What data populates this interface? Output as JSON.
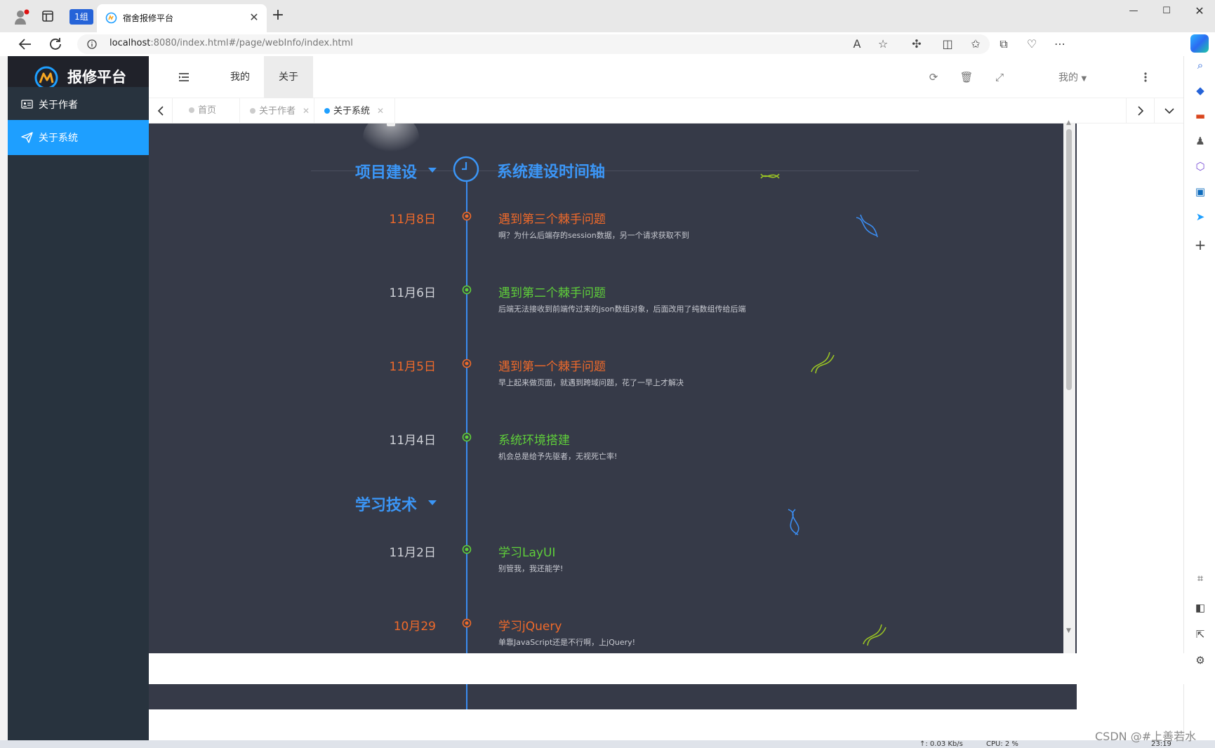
{
  "browser": {
    "tab_group": "1组",
    "tab_title": "宿舍报修平台",
    "url_host": "localhost",
    "url_rest": ":8080/index.html#/page/webInfo/index.html"
  },
  "app": {
    "logo_text": "报修平台",
    "menu": [
      {
        "label": "关于作者",
        "icon": "id-card-icon",
        "active": false
      },
      {
        "label": "关于系统",
        "icon": "paper-plane-icon",
        "active": true
      }
    ],
    "nav": {
      "mine": "我的",
      "about": "关于"
    },
    "user_menu": "我的",
    "page_tabs": [
      {
        "label": "首页",
        "active": false,
        "closable": false
      },
      {
        "label": "关于作者",
        "active": false,
        "closable": true
      },
      {
        "label": "关于系统",
        "active": true,
        "closable": true
      }
    ]
  },
  "timeline": {
    "header_title": "系统建设时间轴",
    "sections": [
      {
        "title": "项目建设"
      },
      {
        "title": "学习技术"
      }
    ],
    "events": [
      {
        "date": "11月8日",
        "title": "遇到第三个棘手问题",
        "desc": "啊？为什么后端存的session数据，另一个请求获取不到",
        "color": "orange"
      },
      {
        "date": "11月6日",
        "title": "遇到第二个棘手问题",
        "desc": "后端无法接收到前端传过来的json数组对象，后面改用了纯数组传给后端",
        "color": "green"
      },
      {
        "date": "11月5日",
        "title": "遇到第一个棘手问题",
        "desc": "早上起来做页面，就遇到跨域问题，花了一早上才解决",
        "color": "orange"
      },
      {
        "date": "11月4日",
        "title": "系统环境搭建",
        "desc": "机会总是给予先驱者，无视死亡率!",
        "color": "green"
      },
      {
        "date": "11月2日",
        "title": "学习LayUI",
        "desc": "别管我，我还能学!",
        "color": "green"
      },
      {
        "date": "10月29",
        "title": "学习jQuery",
        "desc": "单靠JavaScript还是不行啊，上jQuery!",
        "color": "orange"
      }
    ]
  },
  "colors": {
    "accent": "#1e9fff",
    "timeline_blue": "#3b96f7",
    "orange": "#f06a2a",
    "green": "#5fcf3a",
    "bg": "#363a48"
  },
  "taskbar": {
    "net": "↑: 0.03 Kb/s",
    "cpu": "CPU: 2 %",
    "time": "23:19"
  },
  "watermark": "CSDN @#上善若水"
}
